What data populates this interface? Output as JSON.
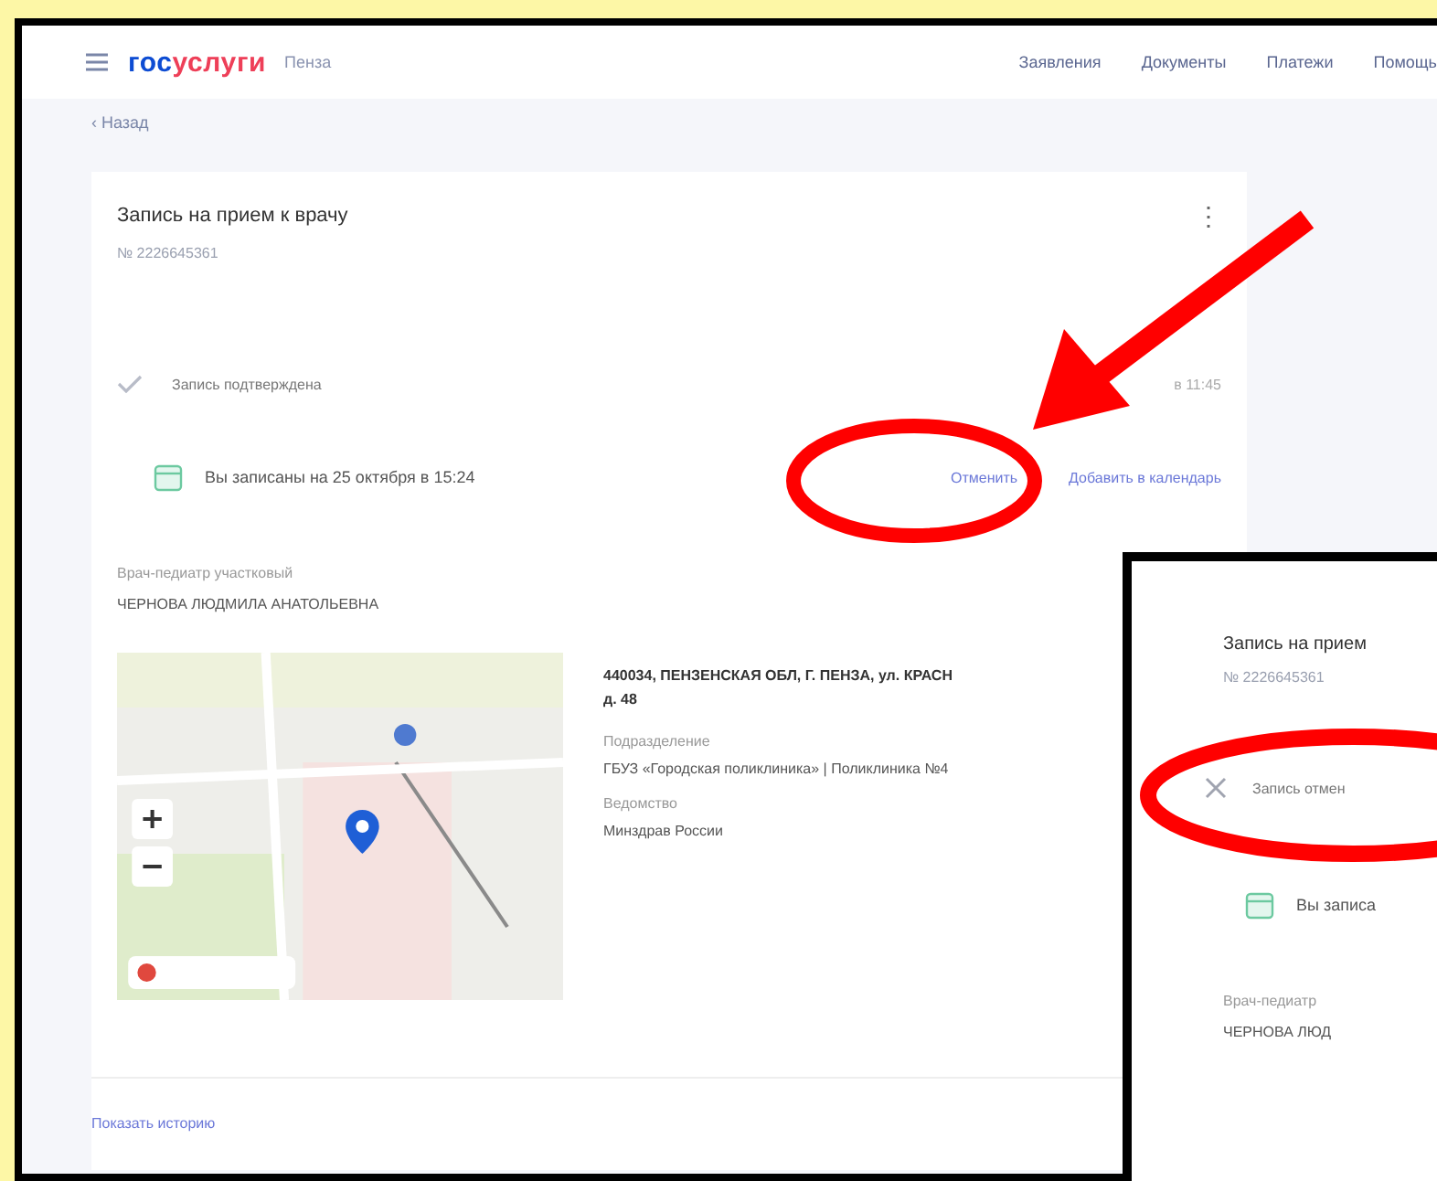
{
  "header": {
    "logo_left": "гос",
    "logo_right": "услуги",
    "region": "Пенза",
    "nav": [
      "Заявления",
      "Документы",
      "Платежи",
      "Помощь"
    ]
  },
  "back_link": "‹ Назад",
  "card": {
    "title": "Запись на прием к врачу",
    "number": "№ 2226645361",
    "menu_icon": "⋮",
    "status": {
      "kind": "confirmed",
      "text": "Запись подтверждена",
      "time": "в 11:45"
    },
    "appointment": "Вы записаны на 25 октября в 15:24",
    "actions": [
      "Отменить",
      "Добавить в календарь"
    ],
    "doctor_label": "Врач-педиатр участковый",
    "doctor": "ЧЕРНОВА ЛЮДМИЛА АНАТОЛЬЕВНА",
    "address": "440034, ПЕНЗЕНСКАЯ ОБЛ, Г. ПЕНЗА, ул. КРАСН",
    "address_2": "д. 48",
    "details": [
      {
        "label": "Подразделение",
        "value": "ГБУЗ «Городская поликлиника» | Поликлиника №4"
      },
      {
        "label": "Ведомство",
        "value": "Минздрав России"
      }
    ],
    "history_link": "Показать историю"
  },
  "inset": {
    "title": "Запись на прием",
    "number": "№ 2226645361",
    "status": {
      "kind": "cancelled",
      "text": "Запись отмен"
    },
    "appointment": "Вы записа",
    "doctor_label": "Врач-педиатр",
    "doctor": "ЧЕРНОВА ЛЮД"
  }
}
